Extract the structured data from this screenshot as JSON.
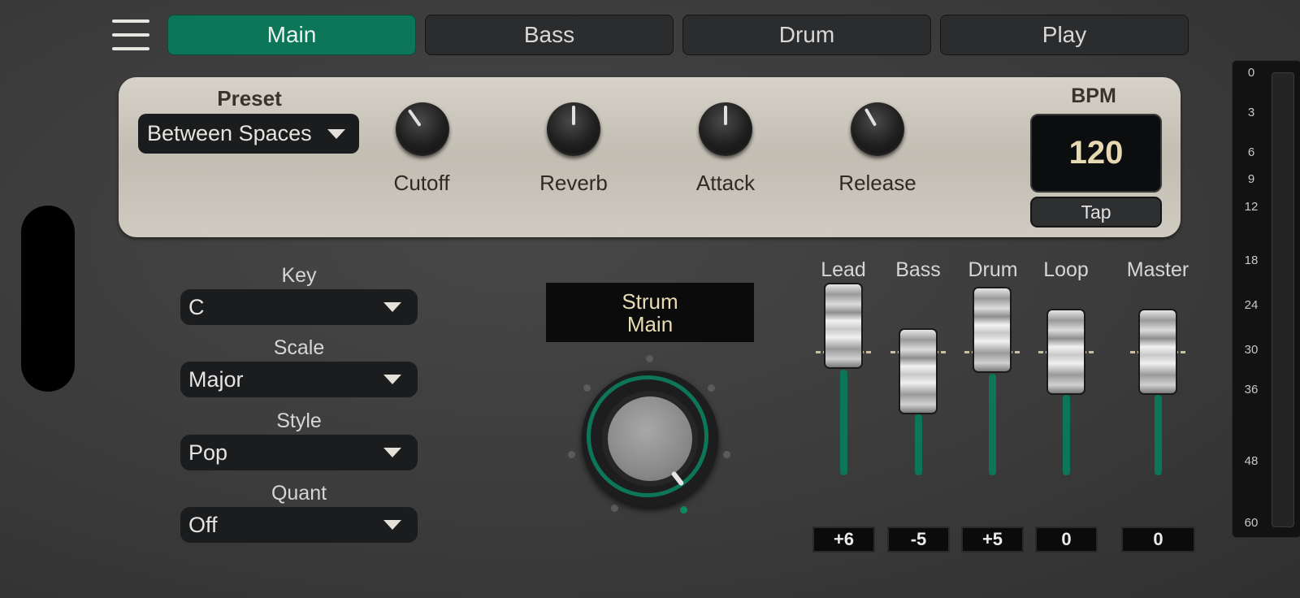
{
  "tabs": [
    {
      "label": "Main",
      "active": true
    },
    {
      "label": "Bass",
      "active": false
    },
    {
      "label": "Drum",
      "active": false
    },
    {
      "label": "Play",
      "active": false
    }
  ],
  "preset": {
    "title": "Preset",
    "value": "Between Spaces"
  },
  "knobs": [
    {
      "label": "Cutoff"
    },
    {
      "label": "Reverb"
    },
    {
      "label": "Attack"
    },
    {
      "label": "Release"
    }
  ],
  "bpm": {
    "title": "BPM",
    "value": "120",
    "tap_label": "Tap"
  },
  "fields": {
    "key": {
      "label": "Key",
      "value": "C"
    },
    "scale": {
      "label": "Scale",
      "value": "Major"
    },
    "style": {
      "label": "Style",
      "value": "Pop"
    },
    "quant": {
      "label": "Quant",
      "value": "Off"
    }
  },
  "strum": {
    "line1": "Strum",
    "line2": "Main"
  },
  "mixer": [
    {
      "label": "Lead",
      "value": "+6"
    },
    {
      "label": "Bass",
      "value": "-5"
    },
    {
      "label": "Drum",
      "value": "+5"
    },
    {
      "label": "Loop",
      "value": "0"
    },
    {
      "label": "Master",
      "value": "0"
    }
  ],
  "meter_ticks": [
    "0",
    "3",
    "6",
    "9",
    "12",
    "18",
    "24",
    "30",
    "36",
    "48",
    "60"
  ],
  "colors": {
    "accent": "#0d7558",
    "panel": "#c9c4b9",
    "background": "#3d3d3d"
  },
  "icons": {
    "menu": "hamburger-menu-icon",
    "dropdown": "caret-down-icon"
  }
}
